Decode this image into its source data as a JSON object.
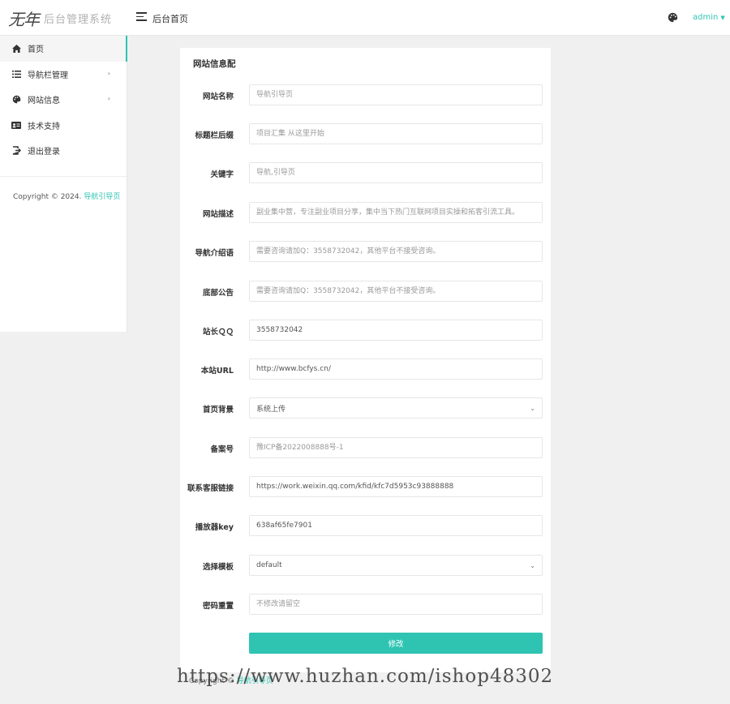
{
  "header": {
    "logo_mark": "无年",
    "logo_text": "后台管理系统",
    "page_title": "后台首页",
    "user": "admin",
    "palette_icon": "palette-icon",
    "menu_icon": "menu-icon"
  },
  "sidebar": {
    "items": [
      {
        "label": "首页",
        "icon": "home-icon",
        "active": true,
        "has_arrow": false
      },
      {
        "label": "导航栏管理",
        "icon": "list-icon",
        "active": false,
        "has_arrow": true
      },
      {
        "label": "网站信息",
        "icon": "palette-icon",
        "active": false,
        "has_arrow": true
      },
      {
        "label": "技术支持",
        "icon": "id-card-icon",
        "active": false,
        "has_arrow": false
      },
      {
        "label": "退出登录",
        "icon": "logout-icon",
        "active": false,
        "has_arrow": false
      }
    ],
    "copyright_prefix": "Copyright © 2024.",
    "copyright_link": "导航引导页"
  },
  "form": {
    "title": "网站信息配",
    "fields": [
      {
        "label": "网站名称",
        "value": "",
        "placeholder": "导航引导页"
      },
      {
        "label": "标题栏后缀",
        "value": "",
        "placeholder": "项目汇集 从这里开始"
      },
      {
        "label": "关键字",
        "value": "",
        "placeholder": "导航,引导页"
      },
      {
        "label": "网站描述",
        "value": "",
        "placeholder": "副业集中营，专注副业项目分享，集中当下热门互联网项目实操和拓客引流工具。"
      },
      {
        "label": "导航介绍语",
        "value": "",
        "placeholder": "需要咨询请加Q：3558732042，其他平台不接受咨询。"
      },
      {
        "label": "底部公告",
        "value": "",
        "placeholder": "需要咨询请加Q：3558732042，其他平台不接受咨询。"
      },
      {
        "label": "站长ＱＱ",
        "value": "3558732042",
        "placeholder": ""
      },
      {
        "label": "本站URL",
        "value": "http://www.bcfys.cn/",
        "placeholder": ""
      },
      {
        "label": "首页背景",
        "select": "系统上传"
      },
      {
        "label": "备案号",
        "value": "",
        "placeholder": "豫ICP备2022008888号-1"
      },
      {
        "label": "联系客服链接",
        "value": "https://work.weixin.qq.com/kfid/kfc7d5953c93888888",
        "placeholder": ""
      },
      {
        "label": "播放器key",
        "value": "638af65fe7901",
        "placeholder": ""
      },
      {
        "label": "选择模板",
        "select": "default"
      },
      {
        "label": "密码重置",
        "value": "",
        "placeholder": "不修改请留空"
      }
    ],
    "submit_label": "修改"
  },
  "watermark": "https://www.huzhan.com/ishop48302",
  "footer_partial": {
    "prefix": "Copyright ©",
    "link": "导航引导页"
  }
}
